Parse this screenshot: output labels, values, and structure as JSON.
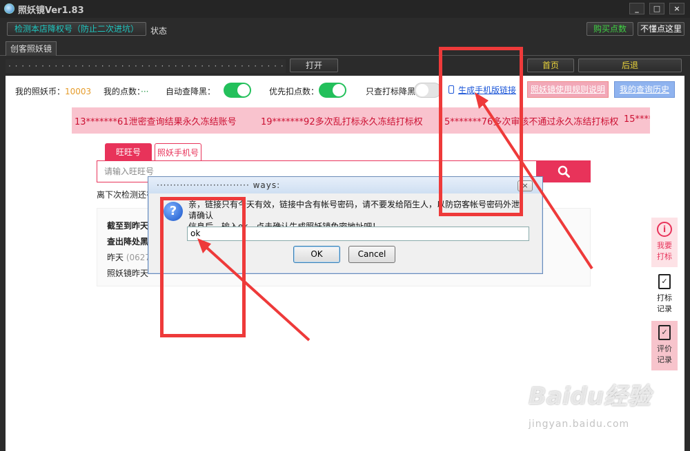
{
  "window": {
    "title": "照妖镜Ver1.83",
    "controls": [
      "_",
      "□",
      "×"
    ]
  },
  "toolbar": {
    "detect_button": "检测本店降权号（防止二次进坑）",
    "status_label": "状态",
    "buy_button": "购买点数",
    "help_button": "不懂点这里"
  },
  "tabs": [
    "创客照妖镜"
  ],
  "address_bar": {
    "value": "· · · · · · · · · · · · · · · · · · · · · · · · · · · · · · · · · · · · · · · · · · · · · · · ·",
    "open_button": "打开",
    "home_button": "首页",
    "back_button": "后退"
  },
  "stats": {
    "coins_label": "我的照妖币：",
    "coins_value": "10003",
    "points_label": "我的点数：",
    "points_value": "···",
    "auto_check_label": "自动查降黑：",
    "priority_label": "优先扣点数：",
    "only_mark_label": "只查打标降黑"
  },
  "links": {
    "mobile_link": "生成手机版链接",
    "rules_button": "照妖镜使用规则说明",
    "history_button": "我的查询历史"
  },
  "ticker": [
    "13*******61泄密查询结果永久冻结账号",
    "19*******92多次乱打标永久冻结打标权",
    "5*******76多次审核不通过永久冻结打标权",
    "15****"
  ],
  "query_tabs": [
    "旺旺号",
    "照妖手机号"
  ],
  "search": {
    "placeholder": "请输入旺旺号"
  },
  "note": "离下次检测还有",
  "result_box": {
    "line1": "截至到昨天",
    "line2": "查出降处黑",
    "line3_label": "昨天",
    "line3_val": "(0627",
    "line4": "照妖镜昨天"
  },
  "side_panel": [
    {
      "label1": "我要",
      "label2": "打标"
    },
    {
      "label1": "打标",
      "label2": "记录"
    },
    {
      "label1": "评价",
      "label2": "记录"
    }
  ],
  "dialog": {
    "title": "···························· ways:",
    "close": "×",
    "message_line1": "亲，链接只有今天有效，链接中含有帐号密码，请不要发给陌生人，以防窃客帐号密码外泄！请确认",
    "message_line2": "信息后，输入ok，点击确认生成照妖镜免密地址吧！",
    "input_value": "ok",
    "ok_button": "OK",
    "cancel_button": "Cancel"
  },
  "watermark": {
    "main": "Baidu经验",
    "sub": "jingyan.baidu.com"
  }
}
